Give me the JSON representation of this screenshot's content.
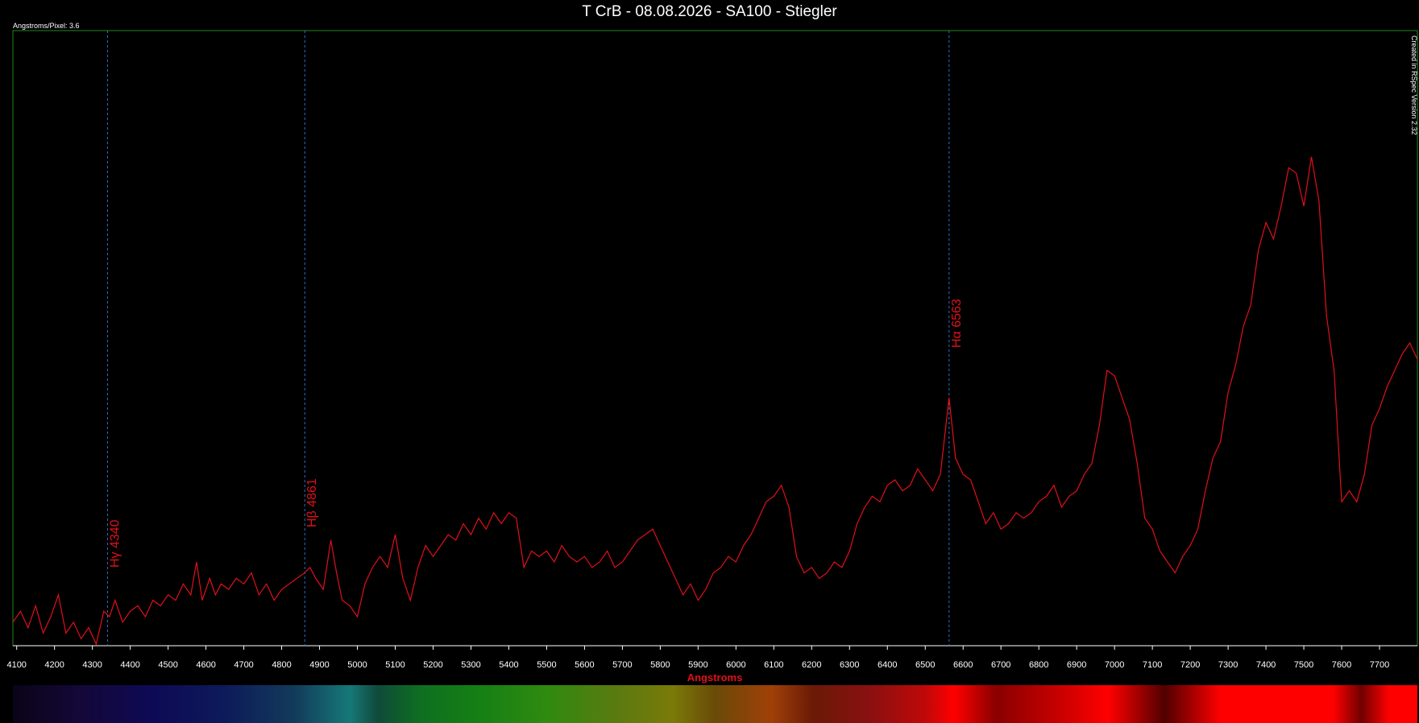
{
  "header": {
    "title": "T CrB - 08.08.2026 - SA100 - Stiegler",
    "pixel_info": "Angstroms/Pixel: 3.6",
    "credit": "Created in RSpec Version 2.32"
  },
  "colors": {
    "plot_frame": "#1f8a1f",
    "spectrum_line": "#e0101a",
    "marker_line": "#2e6fd0",
    "label_red": "#e0101a"
  },
  "chart_data": {
    "type": "line",
    "title": "T CrB - 08.08.2026 - SA100 - Stiegler",
    "xlabel": "Angstroms",
    "ylabel": "",
    "xlim": [
      4090,
      7800
    ],
    "ylim": [
      0,
      1
    ],
    "grid": false,
    "x_ticks": [
      4100,
      4200,
      4300,
      4400,
      4500,
      4600,
      4700,
      4800,
      4900,
      5000,
      5100,
      5200,
      5300,
      5400,
      5500,
      5600,
      5700,
      5800,
      5900,
      6000,
      6100,
      6200,
      6300,
      6400,
      6500,
      6600,
      6700,
      6800,
      6900,
      7000,
      7100,
      7200,
      7300,
      7400,
      7500,
      7600,
      7700
    ],
    "markers": [
      {
        "x": 4340,
        "label": "Hγ 4340"
      },
      {
        "x": 4861,
        "label": "Hβ 4861"
      },
      {
        "x": 6563,
        "label": "Hα 6563"
      }
    ],
    "series": [
      {
        "x": [
          4090,
          4110,
          4130,
          4150,
          4170,
          4190,
          4210,
          4230,
          4250,
          4270,
          4290,
          4310,
          4330,
          4345,
          4360,
          4380,
          4400,
          4420,
          4440,
          4460,
          4480,
          4500,
          4520,
          4540,
          4560,
          4575,
          4590,
          4610,
          4625,
          4640,
          4660,
          4680,
          4700,
          4720,
          4740,
          4760,
          4780,
          4800,
          4820,
          4840,
          4860,
          4875,
          4890,
          4910,
          4930,
          4945,
          4960,
          4980,
          5000,
          5020,
          5040,
          5060,
          5080,
          5100,
          5120,
          5140,
          5160,
          5180,
          5200,
          5220,
          5240,
          5260,
          5280,
          5300,
          5320,
          5340,
          5360,
          5380,
          5400,
          5420,
          5440,
          5460,
          5480,
          5500,
          5520,
          5540,
          5560,
          5580,
          5600,
          5620,
          5640,
          5660,
          5680,
          5700,
          5720,
          5740,
          5760,
          5780,
          5800,
          5820,
          5840,
          5860,
          5880,
          5900,
          5920,
          5940,
          5960,
          5980,
          6000,
          6020,
          6040,
          6060,
          6080,
          6100,
          6120,
          6140,
          6160,
          6180,
          6200,
          6220,
          6240,
          6260,
          6280,
          6300,
          6320,
          6340,
          6360,
          6380,
          6400,
          6420,
          6440,
          6460,
          6480,
          6500,
          6520,
          6540,
          6563,
          6580,
          6600,
          6620,
          6640,
          6660,
          6680,
          6700,
          6720,
          6740,
          6760,
          6780,
          6800,
          6820,
          6840,
          6860,
          6880,
          6900,
          6920,
          6940,
          6960,
          6980,
          7000,
          7020,
          7040,
          7060,
          7080,
          7100,
          7120,
          7140,
          7160,
          7180,
          7200,
          7220,
          7240,
          7260,
          7280,
          7300,
          7320,
          7340,
          7360,
          7380,
          7400,
          7420,
          7440,
          7460,
          7480,
          7500,
          7520,
          7540,
          7560,
          7580,
          7600,
          7620,
          7640,
          7660,
          7680,
          7700,
          7720,
          7740,
          7760,
          7780,
          7800
        ],
        "values": [
          0.04,
          0.06,
          0.03,
          0.07,
          0.02,
          0.05,
          0.09,
          0.02,
          0.04,
          0.01,
          0.03,
          0.0,
          0.06,
          0.05,
          0.08,
          0.04,
          0.06,
          0.07,
          0.05,
          0.08,
          0.07,
          0.09,
          0.08,
          0.11,
          0.09,
          0.15,
          0.08,
          0.12,
          0.09,
          0.11,
          0.1,
          0.12,
          0.11,
          0.13,
          0.09,
          0.11,
          0.08,
          0.1,
          0.11,
          0.12,
          0.13,
          0.14,
          0.12,
          0.1,
          0.19,
          0.13,
          0.08,
          0.07,
          0.05,
          0.11,
          0.14,
          0.16,
          0.14,
          0.2,
          0.12,
          0.08,
          0.14,
          0.18,
          0.16,
          0.18,
          0.2,
          0.19,
          0.22,
          0.2,
          0.23,
          0.21,
          0.24,
          0.22,
          0.24,
          0.23,
          0.14,
          0.17,
          0.16,
          0.17,
          0.15,
          0.18,
          0.16,
          0.15,
          0.16,
          0.14,
          0.15,
          0.17,
          0.14,
          0.15,
          0.17,
          0.19,
          0.2,
          0.21,
          0.18,
          0.15,
          0.12,
          0.09,
          0.11,
          0.08,
          0.1,
          0.13,
          0.14,
          0.16,
          0.15,
          0.18,
          0.2,
          0.23,
          0.26,
          0.27,
          0.29,
          0.25,
          0.16,
          0.13,
          0.14,
          0.12,
          0.13,
          0.15,
          0.14,
          0.17,
          0.22,
          0.25,
          0.27,
          0.26,
          0.29,
          0.3,
          0.28,
          0.29,
          0.32,
          0.3,
          0.28,
          0.31,
          0.45,
          0.34,
          0.31,
          0.3,
          0.26,
          0.22,
          0.24,
          0.21,
          0.22,
          0.24,
          0.23,
          0.24,
          0.26,
          0.27,
          0.29,
          0.25,
          0.27,
          0.28,
          0.31,
          0.33,
          0.4,
          0.5,
          0.49,
          0.45,
          0.41,
          0.33,
          0.23,
          0.21,
          0.17,
          0.15,
          0.13,
          0.16,
          0.18,
          0.21,
          0.28,
          0.34,
          0.37,
          0.46,
          0.51,
          0.58,
          0.62,
          0.72,
          0.77,
          0.74,
          0.8,
          0.87,
          0.86,
          0.8,
          0.89,
          0.81,
          0.6,
          0.5,
          0.26,
          0.28,
          0.26,
          0.31,
          0.4,
          0.43,
          0.47,
          0.5,
          0.53,
          0.55,
          0.52
        ]
      }
    ]
  },
  "spectrum_bar": {
    "stops": [
      {
        "offset": 0.0,
        "color": "#0a0418"
      },
      {
        "offset": 0.05,
        "color": "#14083a"
      },
      {
        "offset": 0.1,
        "color": "#0d0a55"
      },
      {
        "offset": 0.15,
        "color": "#0d1a5a"
      },
      {
        "offset": 0.2,
        "color": "#123a5a"
      },
      {
        "offset": 0.24,
        "color": "#167878"
      },
      {
        "offset": 0.26,
        "color": "#0f4a3a"
      },
      {
        "offset": 0.29,
        "color": "#0e6f20"
      },
      {
        "offset": 0.33,
        "color": "#147f14"
      },
      {
        "offset": 0.38,
        "color": "#2f8a10"
      },
      {
        "offset": 0.43,
        "color": "#5a7a10"
      },
      {
        "offset": 0.47,
        "color": "#7a7a08"
      },
      {
        "offset": 0.5,
        "color": "#6a4a08"
      },
      {
        "offset": 0.54,
        "color": "#a04008"
      },
      {
        "offset": 0.57,
        "color": "#6a1a06"
      },
      {
        "offset": 0.61,
        "color": "#8a1010"
      },
      {
        "offset": 0.65,
        "color": "#c00808"
      },
      {
        "offset": 0.67,
        "color": "#ff0000"
      },
      {
        "offset": 0.7,
        "color": "#8a0000"
      },
      {
        "offset": 0.74,
        "color": "#c00000"
      },
      {
        "offset": 0.78,
        "color": "#ff0000"
      },
      {
        "offset": 0.82,
        "color": "#500000"
      },
      {
        "offset": 0.86,
        "color": "#ff0000"
      },
      {
        "offset": 0.94,
        "color": "#ff0000"
      },
      {
        "offset": 0.96,
        "color": "#700000"
      },
      {
        "offset": 0.98,
        "color": "#ff0000"
      },
      {
        "offset": 1.0,
        "color": "#ff0000"
      }
    ]
  }
}
